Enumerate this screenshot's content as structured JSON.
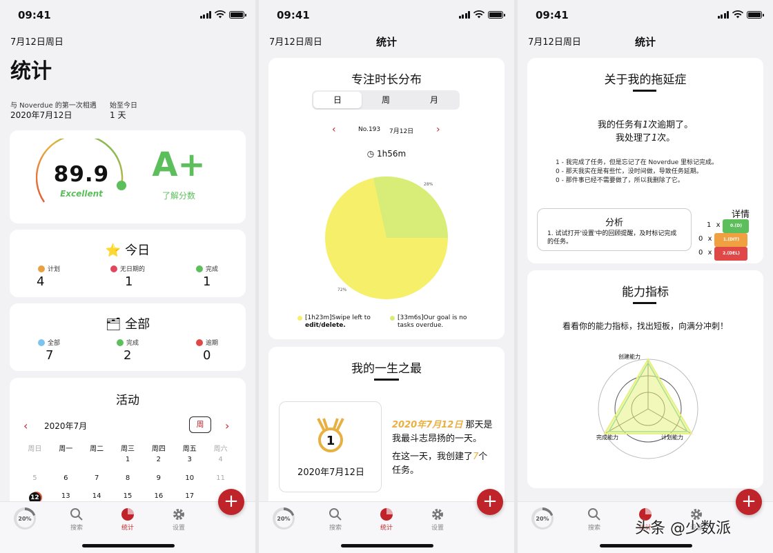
{
  "status": {
    "time": "09:41"
  },
  "common": {
    "date": "7月12日周日",
    "stats_title": "统计"
  },
  "tabbar": {
    "progress": "20%",
    "search": "搜索",
    "stats": "统计",
    "settings": "设置",
    "fab": "+"
  },
  "p1": {
    "title": "统计",
    "first_meet_label": "与 Noverdue 的第一次相遇",
    "first_meet_value": "2020年7月12日",
    "since_label": "始至今日",
    "since_value": "1 天",
    "score": "89.9",
    "score_text": "Excellent",
    "grade": "A+",
    "grade_link": "了解分数",
    "today": {
      "title": "今日",
      "plan": "计划",
      "plan_val": "4",
      "nodate": "无日期的",
      "nodate_val": "1",
      "done": "完成",
      "done_val": "1"
    },
    "all": {
      "title": "全部",
      "all": "全部",
      "all_val": "7",
      "done": "完成",
      "done_val": "2",
      "overdue": "逾期",
      "overdue_val": "0"
    },
    "activity": {
      "title": "活动",
      "month": "2020年7月",
      "mode": "周",
      "weekdays": [
        "周日",
        "周一",
        "周二",
        "周三",
        "周四",
        "周五",
        "周六"
      ],
      "week1": [
        "",
        "",
        "",
        "1",
        "2",
        "3",
        "4"
      ],
      "week2": [
        "5",
        "6",
        "7",
        "8",
        "9",
        "10",
        "11"
      ],
      "week3": [
        "12",
        "13",
        "14",
        "15",
        "16",
        "17",
        ""
      ]
    }
  },
  "p2": {
    "focus": {
      "title": "专注时长分布",
      "seg": [
        "日",
        "周",
        "月"
      ],
      "no": "No.193",
      "date": "7月12日",
      "total": "1h56m",
      "pct_small": "28%",
      "pct_big": "72%",
      "legend1_a": "[1h23m]Swipe left to",
      "legend1_b": "edit/delete.",
      "legend2_a": "[33m6s]Our goal is no",
      "legend2_b": "tasks overdue."
    },
    "best": {
      "title": "我的一生之最",
      "medal_date": "2020年7月12日",
      "date_hl": "2020年7月12日",
      "line1_rest": "那天是",
      "line2": "我最斗志昂扬的一天。",
      "line3_a": "在这一天，我创建了",
      "line3_num": "7",
      "line3_b": "个",
      "line4": "任务。"
    }
  },
  "p3": {
    "proc": {
      "title": "关于我的拖延症",
      "line1_a": "我的任务有",
      "line1_num": "1",
      "line1_b": "次逾期了。",
      "line2_a": "我处理了",
      "line2_num": "1",
      "line2_b": "次。",
      "note1": "1 - 我完成了任务，但是忘记了在 Noverdue 里标记完成。",
      "note2": "0 - 那天我实在是有些忙，没时间做，导致任务延期。",
      "note3": "0 - 那件事已经不需要做了，所以我删除了它。",
      "analysis_title": "分析",
      "analysis_text": "1. 试试打开'设置'中的回顾提醒，及时标记完成的任务。",
      "detail_title": "详情",
      "details": [
        {
          "n": "1",
          "x": "x",
          "tag": "0.(D)",
          "color": "#5cbf5c"
        },
        {
          "n": "0",
          "x": "x",
          "tag": "1.(DIT)",
          "color": "#f0a040"
        },
        {
          "n": "0",
          "x": "x",
          "tag": "2.(DEL)",
          "color": "#e04848"
        }
      ]
    },
    "ability": {
      "title": "能力指标",
      "subtitle": "看看你的能力指标，找出短板，向满分冲刺！",
      "axis_top": "创建能力",
      "axis_left": "完成能力",
      "axis_right": "计划能力"
    }
  },
  "watermark": "头条 @少数派"
}
